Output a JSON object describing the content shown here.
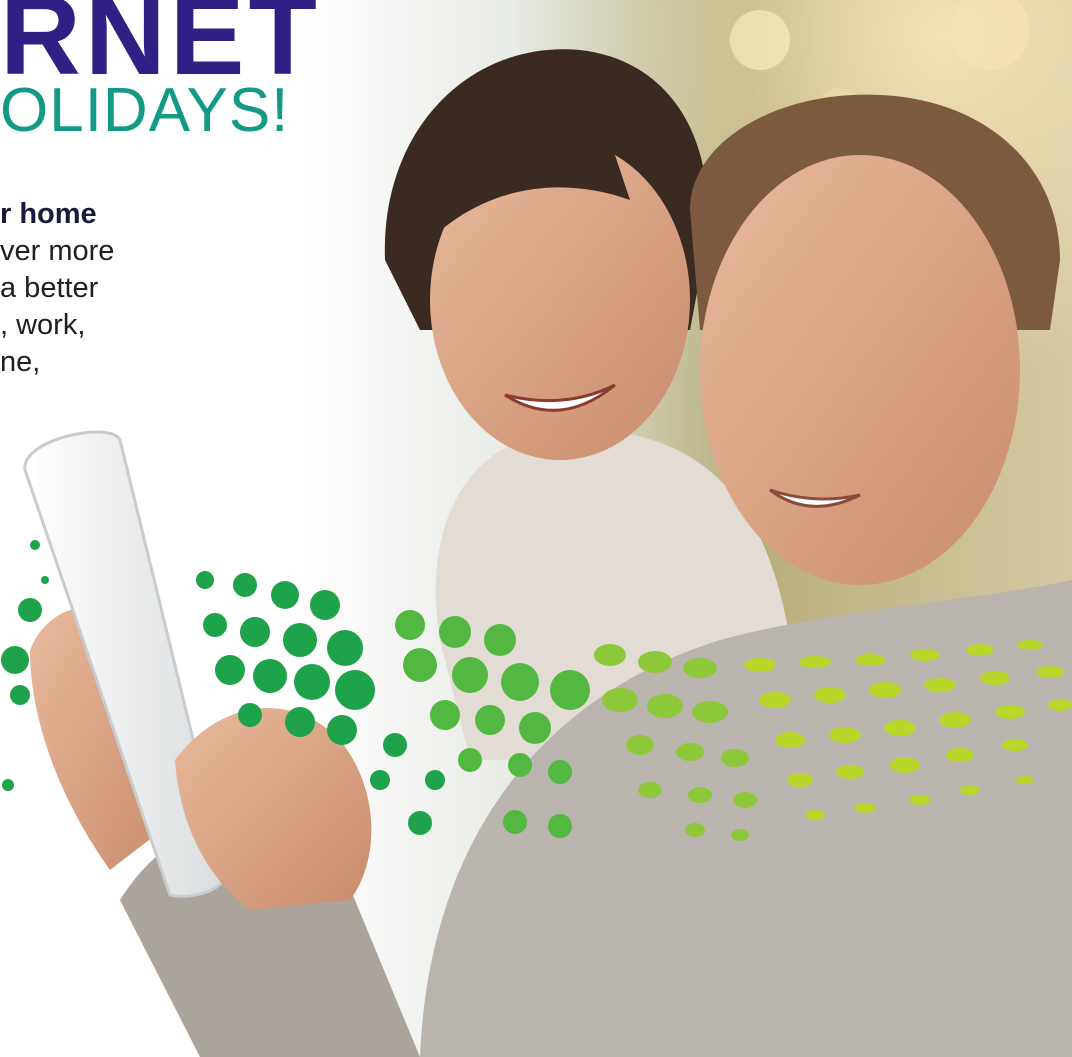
{
  "headline": "RNET",
  "subheadline": "OLIDAYS!",
  "body_lines": [
    "r home",
    "ver more",
    "a better",
    ", work,",
    "ne,"
  ],
  "colors": {
    "headline": "#2e2085",
    "subheadline": "#139a85",
    "body": "#1f1f1f",
    "dots_dark_green": "#1fa34a",
    "dots_lime": "#b8d62a",
    "sweater": "#b9b4ae"
  }
}
